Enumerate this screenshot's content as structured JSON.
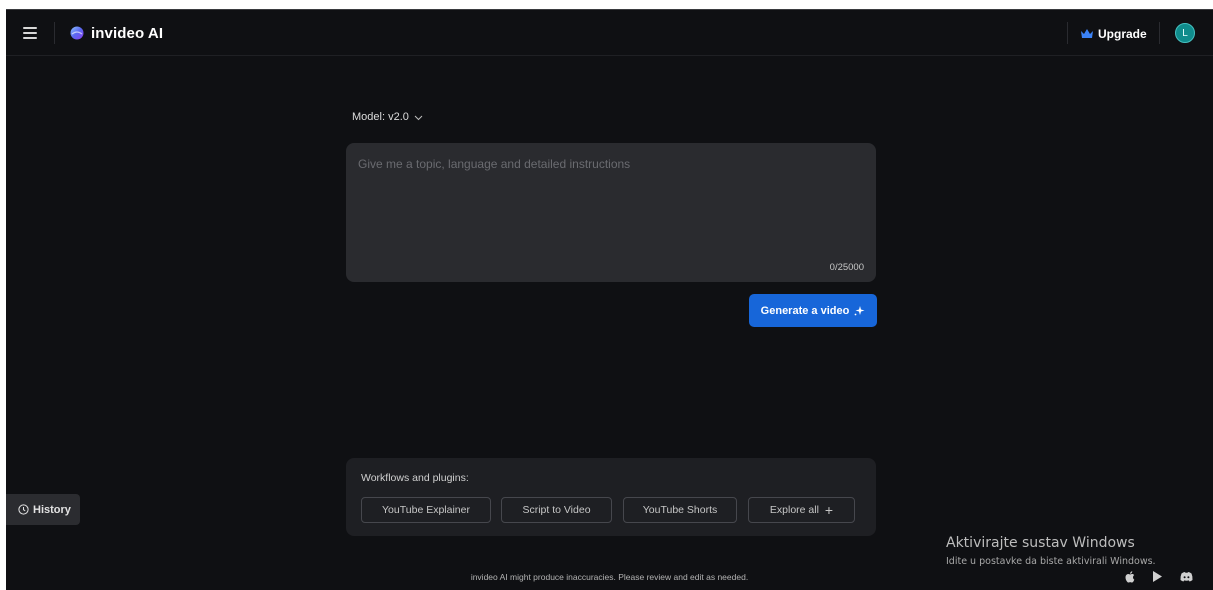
{
  "header": {
    "brand": "invideo AI",
    "upgrade_label": "Upgrade",
    "avatar_initial": "L"
  },
  "composer": {
    "model_label": "Model: v2.0",
    "prompt_placeholder": "Give me a topic, language and detailed instructions",
    "prompt_value": "",
    "char_counter": "0/25000",
    "generate_label": "Generate a video"
  },
  "workflows": {
    "title": "Workflows and plugins:",
    "chips": [
      {
        "label": "YouTube Explainer"
      },
      {
        "label": "Script to Video"
      },
      {
        "label": "YouTube Shorts"
      },
      {
        "label": "Explore all"
      }
    ]
  },
  "sidebar": {
    "history_label": "History"
  },
  "footer": {
    "disclaimer": "invideo AI might produce inaccuracies. Please review and edit as needed.",
    "app_icons": [
      "apple-icon",
      "google-play-icon",
      "discord-icon"
    ]
  },
  "os_overlay": {
    "activation_title": "Aktivirajte sustav Windows",
    "activation_subtitle": "Idite u postavke da biste aktivirali Windows."
  },
  "colors": {
    "background": "#0f1013",
    "accent_blue": "#1766d9",
    "avatar_teal": "#0f8c8c",
    "crown_blue": "#3b82f6"
  }
}
